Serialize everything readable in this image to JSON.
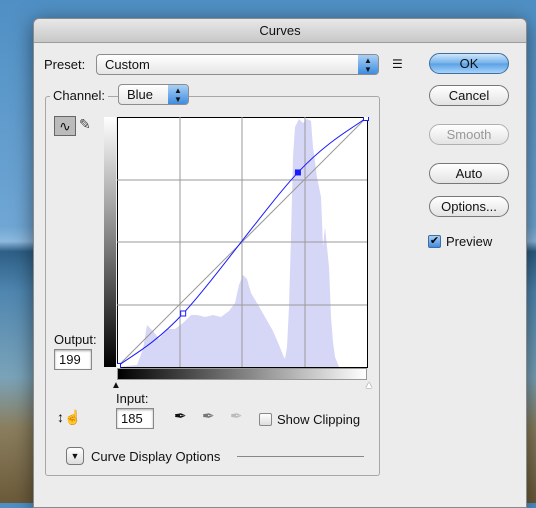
{
  "dialog": {
    "title": "Curves"
  },
  "preset": {
    "label": "Preset:",
    "value": "Custom"
  },
  "channel": {
    "label": "Channel:",
    "value": "Blue"
  },
  "buttons": {
    "ok": "OK",
    "cancel": "Cancel",
    "smooth": "Smooth",
    "auto": "Auto",
    "options": "Options..."
  },
  "preview": {
    "label": "Preview",
    "checked": true
  },
  "output": {
    "label": "Output:",
    "value": "199"
  },
  "input": {
    "label": "Input:",
    "value": "185"
  },
  "show_clipping": {
    "label": "Show Clipping",
    "checked": false
  },
  "curve_display": {
    "label": "Curve Display Options"
  },
  "curve_points": [
    [
      0,
      0
    ],
    [
      67,
      54
    ],
    [
      185,
      199
    ],
    [
      255,
      255
    ]
  ],
  "colors": {
    "curve": "#1a1aff",
    "histogram": "#d6d6f6",
    "ok_button": "#5aa0e6"
  }
}
